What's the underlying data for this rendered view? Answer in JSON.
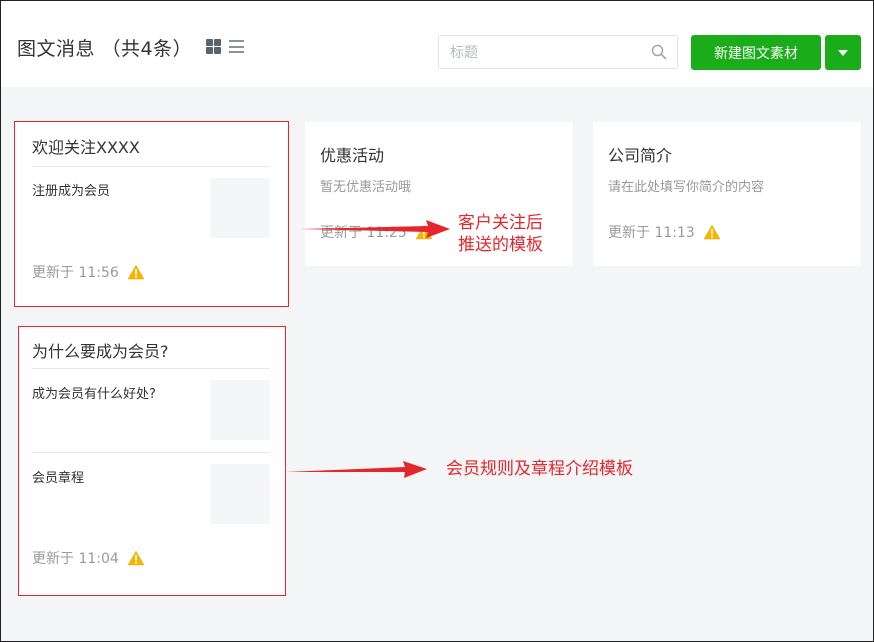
{
  "header": {
    "title": "图文消息 （共4条）",
    "search_placeholder": "标题",
    "new_button_label": "新建图文素材"
  },
  "cards": {
    "welcome": {
      "title": "欢迎关注XXXX",
      "sub_title": "注册成为会员",
      "updated": "更新于 11:56"
    },
    "promo": {
      "title": "优惠活动",
      "desc": "暂无优惠活动哦",
      "updated": "更新于 11:25"
    },
    "company": {
      "title": "公司简介",
      "desc": "请在此处填写你简介的内容",
      "updated": "更新于 11:13"
    },
    "member": {
      "title": "为什么要成为会员?",
      "sub_titles": [
        "成为会员有什么好处?",
        "会员章程"
      ],
      "updated": "更新于 11:04"
    }
  },
  "annotations": {
    "follow_push_line1": "客户关注后",
    "follow_push_line2": "推送的模板",
    "member_rules": "会员规则及章程介绍模板"
  },
  "colors": {
    "primary_green": "#1aad19",
    "annotation_red": "#e3272c",
    "warning_yellow": "#f5b400"
  }
}
